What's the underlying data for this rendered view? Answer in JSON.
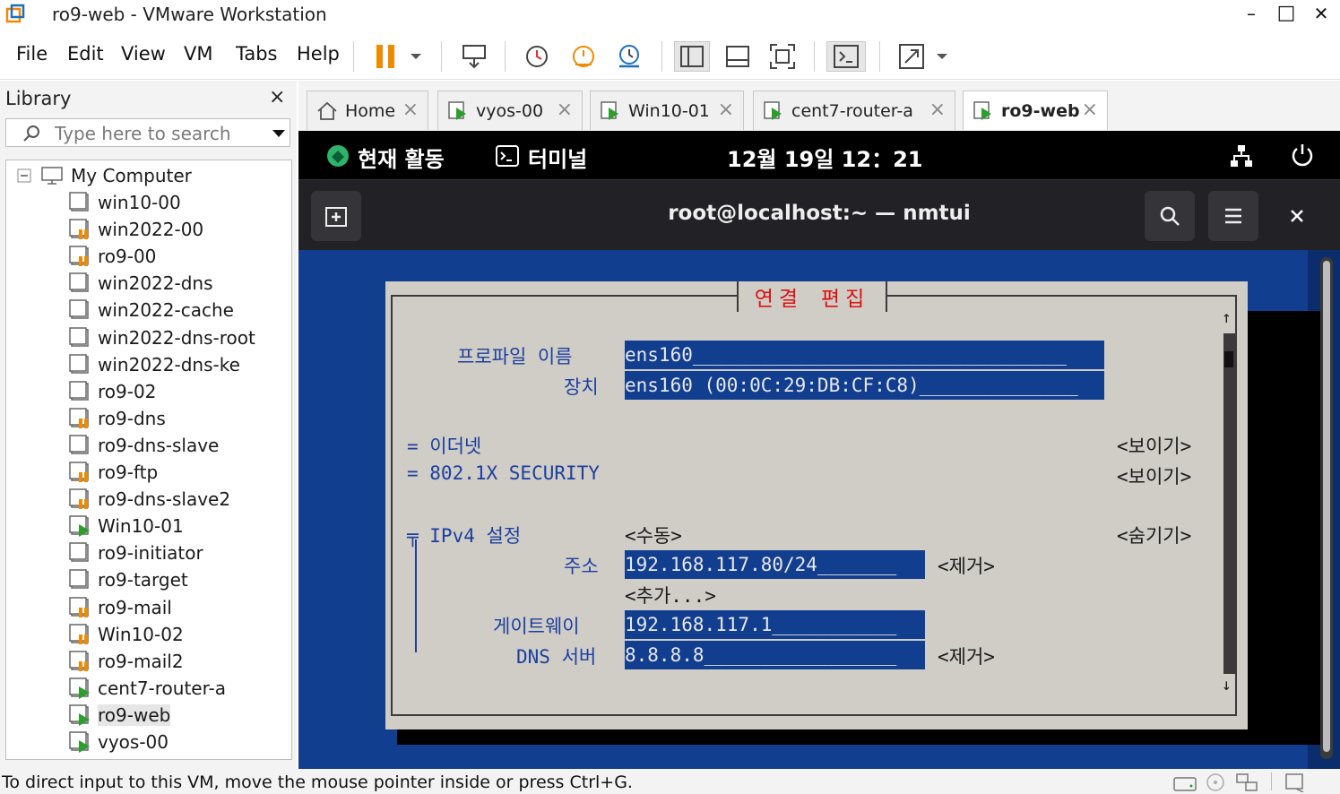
{
  "window": {
    "title": "ro9-web - VMware Workstation",
    "minimize": "–",
    "maximize": "□",
    "close": "✕"
  },
  "menu": {
    "file": "File",
    "edit": "Edit",
    "view": "View",
    "vm": "VM",
    "tabs": "Tabs",
    "help": "Help"
  },
  "library": {
    "title": "Library",
    "close": "×",
    "search_placeholder": "Type here to search",
    "root_label": "My Computer",
    "items": [
      {
        "label": "win10-00",
        "state": "off"
      },
      {
        "label": "win2022-00",
        "state": "suspended"
      },
      {
        "label": "ro9-00",
        "state": "suspended"
      },
      {
        "label": "win2022-dns",
        "state": "off"
      },
      {
        "label": "win2022-cache",
        "state": "off"
      },
      {
        "label": "win2022-dns-root",
        "state": "off"
      },
      {
        "label": "win2022-dns-ke",
        "state": "off"
      },
      {
        "label": "ro9-02",
        "state": "off"
      },
      {
        "label": "ro9-dns",
        "state": "suspended"
      },
      {
        "label": "ro9-dns-slave",
        "state": "off"
      },
      {
        "label": "ro9-ftp",
        "state": "suspended"
      },
      {
        "label": "ro9-dns-slave2",
        "state": "suspended"
      },
      {
        "label": "Win10-01",
        "state": "running"
      },
      {
        "label": "ro9-initiator",
        "state": "off"
      },
      {
        "label": "ro9-target",
        "state": "off"
      },
      {
        "label": "ro9-mail",
        "state": "suspended"
      },
      {
        "label": "Win10-02",
        "state": "suspended"
      },
      {
        "label": "ro9-mail2",
        "state": "suspended"
      },
      {
        "label": "cent7-router-a",
        "state": "running"
      },
      {
        "label": "ro9-web",
        "state": "running"
      },
      {
        "label": "vyos-00",
        "state": "running"
      }
    ]
  },
  "tabs": [
    {
      "label": "Home",
      "icon": "home-icon"
    },
    {
      "label": "vyos-00",
      "icon": "vm-running-icon"
    },
    {
      "label": "Win10-01",
      "icon": "vm-running-icon"
    },
    {
      "label": "cent7-router-a",
      "icon": "vm-running-icon"
    },
    {
      "label": "ro9-web",
      "icon": "vm-running-icon"
    }
  ],
  "gnome": {
    "activities": "현재 활동",
    "app": "터미널",
    "clock": "12월 19일  12：21"
  },
  "terminal": {
    "title": "root@localhost:~ — nmtui"
  },
  "nmtui": {
    "dialog_title": "연결 편집",
    "profile_name_label": "프로파일 이름",
    "profile_name_value": "ens160_________________________________",
    "device_label": "장치",
    "device_value": "ens160 (00:0C:29:DB:CF:C8)______________",
    "ethernet_label": "= 이더넷",
    "ethernet_action": "<보이기>",
    "security_label": "= 802.1X SECURITY",
    "security_action": "<보이기>",
    "ipv4_label": "╤ IPv4 설정",
    "ipv4_mode": "<수동>",
    "ipv4_action": "<숨기기>",
    "address_label": "주소",
    "address_value": "192.168.117.80/24_______",
    "address_remove": "<제거>",
    "add": "<추가...>",
    "gateway_label": "게이트웨이",
    "gateway_value": "192.168.117.1___________",
    "dns_label": "DNS 서버",
    "dns_value": "8.8.8.8_________________",
    "dns_remove": "<제거>",
    "scroll_up": "↑",
    "scroll_down": "↓"
  },
  "status": {
    "message": "To direct input to this VM, move the mouse pointer inside or press Ctrl+G."
  },
  "colors": {
    "terminal_blue": "#123e90",
    "dialog_gray": "#cfcdc6",
    "nmtui_label": "#1c3f9f",
    "dialog_title_red": "#d11111",
    "vmware_orange": "#f08a00",
    "running_green": "#2e9d2e"
  }
}
